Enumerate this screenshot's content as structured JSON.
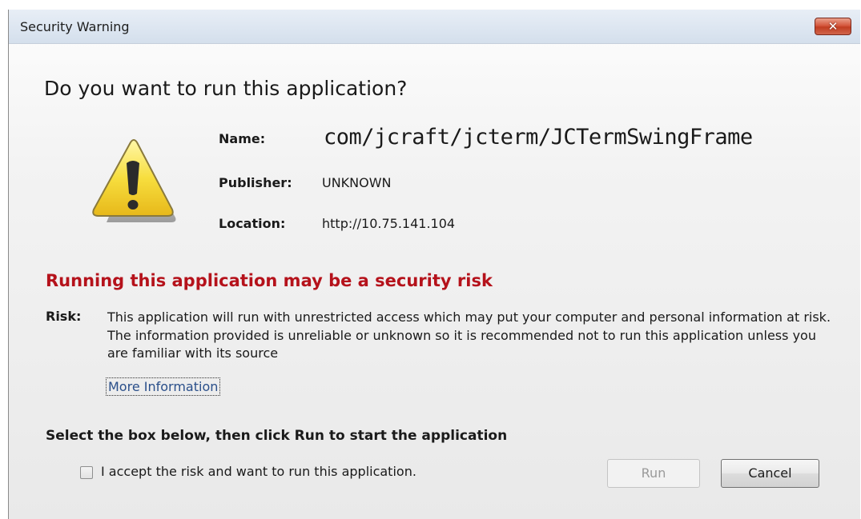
{
  "window": {
    "title": "Security Warning",
    "close_symbol": "✕"
  },
  "dialog": {
    "heading": "Do you want to run this application?",
    "icon": "warning-icon",
    "fields": {
      "name_label": "Name:",
      "name_value": "com/jcraft/jcterm/JCTermSwingFrame",
      "publisher_label": "Publisher:",
      "publisher_value": "UNKNOWN",
      "location_label": "Location:",
      "location_value": "http://10.75.141.104"
    },
    "risk_heading": "Running this application may be a security risk",
    "risk_label": "Risk:",
    "risk_text": "This application will run with unrestricted access which may put your computer and personal information at risk. The information provided is unreliable or unknown so it is recommended not to run this application unless you are familiar with its source",
    "more_info_link": "More Information",
    "instruction": "Select the box below, then click Run to start the application",
    "checkbox_label": "I accept the risk and want to run this application.",
    "checkbox_checked": false,
    "run_button": "Run",
    "run_enabled": false,
    "cancel_button": "Cancel"
  },
  "colors": {
    "risk_heading": "#b5121b",
    "close_button": "#c84b32",
    "link": "#2a4f8a"
  }
}
